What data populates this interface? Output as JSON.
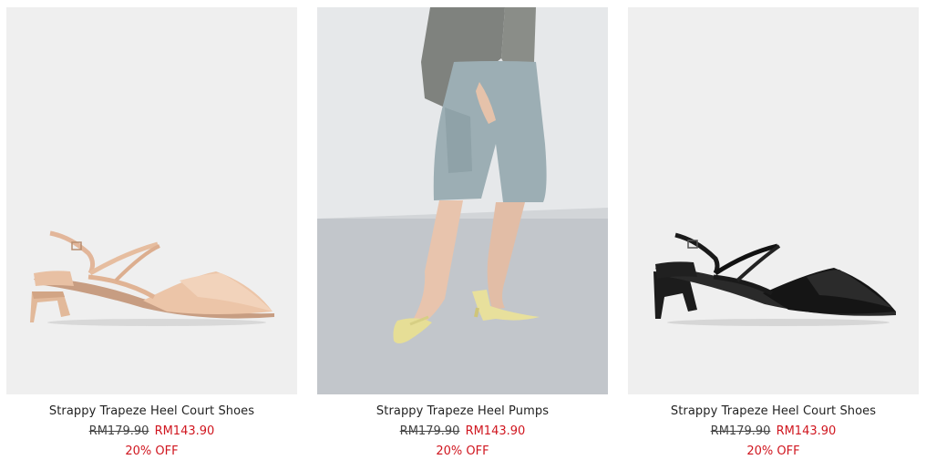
{
  "products": [
    {
      "name": "Strappy Trapeze Heel Court Shoes",
      "old_price": "RM179.90",
      "new_price": "RM143.90",
      "discount": "20% OFF",
      "image": "beige-slingback-shoe-photo"
    },
    {
      "name": "Strappy Trapeze Heel Pumps",
      "old_price": "RM179.90",
      "new_price": "RM143.90",
      "discount": "20% OFF",
      "image": "model-wearing-yellow-pumps-photo"
    },
    {
      "name": "Strappy Trapeze Heel Court Shoes",
      "old_price": "RM179.90",
      "new_price": "RM143.90",
      "discount": "20% OFF",
      "image": "black-slingback-shoe-photo"
    }
  ],
  "colors": {
    "sale": "#d0161f",
    "text": "#222222",
    "image_bg": "#efefef"
  }
}
